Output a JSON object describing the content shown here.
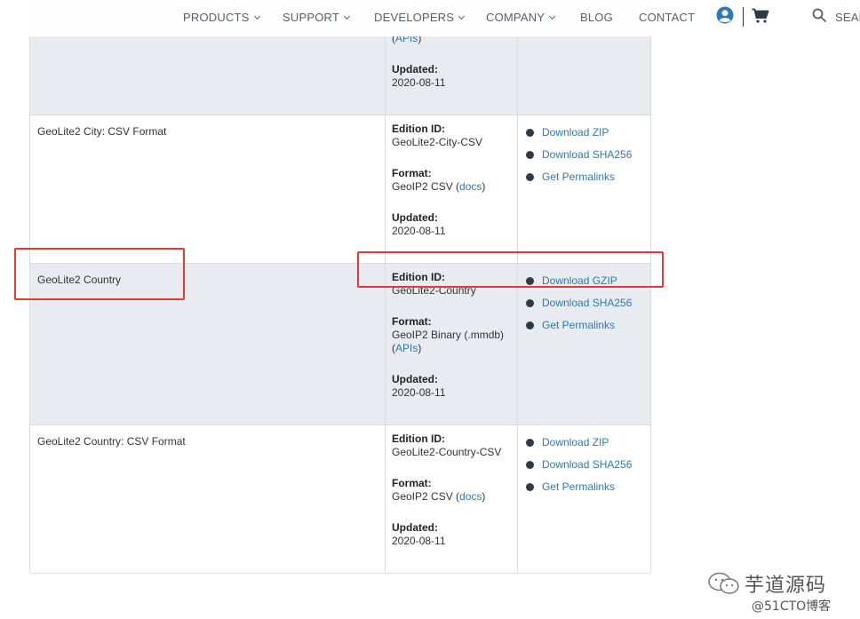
{
  "nav": {
    "items": [
      {
        "label": "PRODUCTS",
        "dropdown": true
      },
      {
        "label": "SUPPORT",
        "dropdown": true
      },
      {
        "label": "DEVELOPERS",
        "dropdown": true
      },
      {
        "label": "COMPANY",
        "dropdown": true
      },
      {
        "label": "BLOG",
        "dropdown": false
      },
      {
        "label": "CONTACT",
        "dropdown": false
      }
    ],
    "search_label": "SEAR",
    "icons": [
      "user-icon",
      "cart-icon",
      "search-icon"
    ],
    "accent_color": "#2d7ab3"
  },
  "table": {
    "rows": [
      {
        "name": "",
        "info": [
          {
            "label": "",
            "value": "",
            "link": "APIs",
            "value_suffix": ")"
          },
          {
            "label": "Updated:",
            "value": "2020-08-11"
          }
        ],
        "links": []
      },
      {
        "name": "GeoLite2 City: CSV Format",
        "info": [
          {
            "label": "Edition ID:",
            "value": "GeoLite2-City-CSV"
          },
          {
            "label": "Format:",
            "value": "GeoIP2 CSV (",
            "link": "docs",
            "value_suffix": ")"
          },
          {
            "label": "Updated:",
            "value": "2020-08-11"
          }
        ],
        "links": [
          "Download ZIP",
          "Download SHA256",
          "Get Permalinks"
        ]
      },
      {
        "name": "GeoLite2 Country",
        "info": [
          {
            "label": "Edition ID:",
            "value": "GeoLite2-Country"
          },
          {
            "label": "Format:",
            "value": "GeoIP2 Binary (.mmdb)",
            "link": "APIs",
            "link_prefix": "(",
            "value_suffix": ")"
          },
          {
            "label": "Updated:",
            "value": "2020-08-11"
          }
        ],
        "links": [
          "Download GZIP",
          "Download SHA256",
          "Get Permalinks"
        ]
      },
      {
        "name": "GeoLite2 Country: CSV Format",
        "info": [
          {
            "label": "Edition ID:",
            "value": "GeoLite2-Country-CSV"
          },
          {
            "label": "Format:",
            "value": "GeoIP2 CSV (",
            "link": "docs",
            "value_suffix": ")"
          },
          {
            "label": "Updated:",
            "value": "2020-08-11"
          }
        ],
        "links": [
          "Download ZIP",
          "Download SHA256",
          "Get Permalinks"
        ]
      }
    ]
  },
  "annotation_color": "#e53935",
  "watermark": {
    "title": "芋道源码",
    "subtitle": "@51CTO博客"
  }
}
